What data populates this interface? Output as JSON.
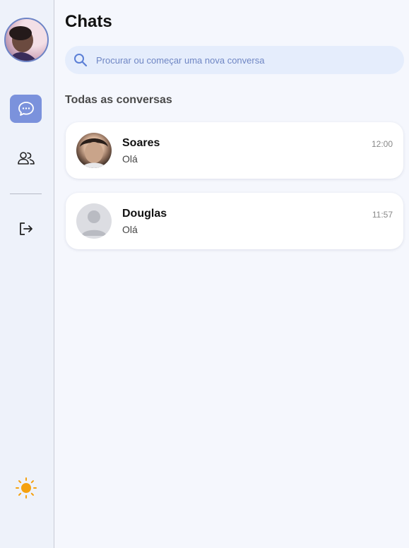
{
  "main": {
    "title": "Chats",
    "search": {
      "placeholder": "Procurar ou começar uma nova conversa"
    },
    "section_label": "Todas as conversas",
    "chats": [
      {
        "name": "Soares",
        "preview": "Olá",
        "time": "12:00",
        "avatar": "photo"
      },
      {
        "name": "Douglas",
        "preview": "Olá",
        "time": "11:57",
        "avatar": "default-user-icon"
      }
    ]
  },
  "sidebar": {
    "icons": [
      "user-avatar",
      "chat-bubble-icon",
      "users-icon",
      "logout-icon",
      "sun-icon"
    ]
  },
  "colors": {
    "accent": "#7b92dc",
    "background": "#f5f7fd",
    "sidebar": "#eef2fa",
    "search_bg": "#e5edfc",
    "sun": "#f5a10f"
  }
}
